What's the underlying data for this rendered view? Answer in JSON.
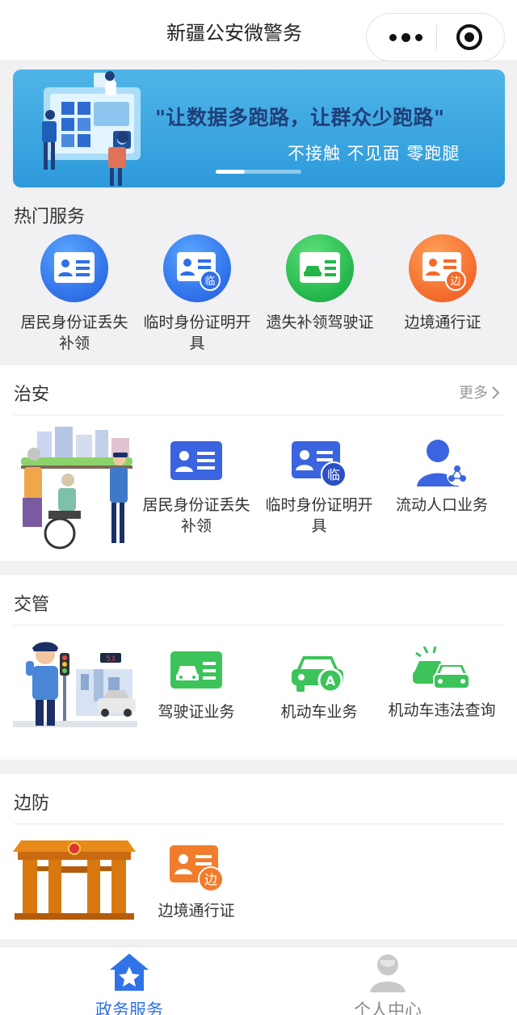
{
  "app": {
    "title": "新疆公安微警务"
  },
  "banner": {
    "slogan": "\"让数据多跑路，让群众少跑路\"",
    "sub": "不接触  不见面  零跑腿"
  },
  "hot": {
    "title": "热门服务",
    "items": [
      {
        "label": "居民身份证丢失补领",
        "icon": "id-card-icon",
        "color": "#2f6fe8"
      },
      {
        "label": "临时身份证明开具",
        "icon": "temp-id-card-icon",
        "color": "#2f6fe8"
      },
      {
        "label": "遗失补领驾驶证",
        "icon": "driver-license-icon",
        "color": "#22b64a"
      },
      {
        "label": "边境通行证",
        "icon": "border-pass-icon",
        "color": "#f46a2a"
      }
    ]
  },
  "security": {
    "title": "治安",
    "more": "更多",
    "items": [
      {
        "label": "居民身份证丢失补领",
        "icon": "id-card-icon"
      },
      {
        "label": "临时身份证明开具",
        "icon": "temp-id-card-icon"
      },
      {
        "label": "流动人口业务",
        "icon": "floating-population-icon"
      }
    ]
  },
  "traffic": {
    "title": "交管",
    "items": [
      {
        "label": "驾驶证业务",
        "icon": "driver-license-icon"
      },
      {
        "label": "机动车业务",
        "icon": "car-icon"
      },
      {
        "label": "机动车违法查询",
        "icon": "car-violation-icon"
      }
    ]
  },
  "border": {
    "title": "边防",
    "items": [
      {
        "label": "边境通行证",
        "icon": "border-pass-icon"
      }
    ]
  },
  "tabbar": {
    "tabs": [
      {
        "label": "政务服务",
        "icon": "home-star-icon",
        "active": true
      },
      {
        "label": "个人中心",
        "icon": "user-icon",
        "active": false
      }
    ]
  },
  "colors": {
    "accent": "#2f73e6",
    "blue": "#2f6fe8",
    "green": "#3cc35a",
    "orange": "#f46a2a"
  }
}
